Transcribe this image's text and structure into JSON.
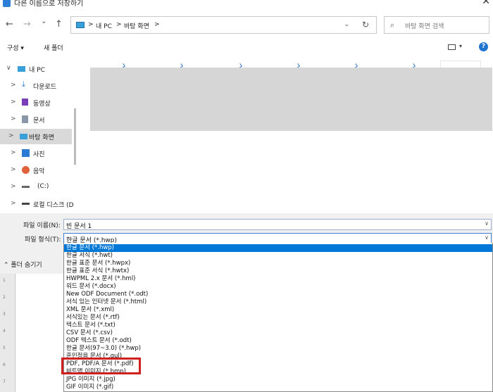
{
  "window": {
    "title": "다른 이름으로 저장하기",
    "close": "✕"
  },
  "nav": {
    "back": "←",
    "forward": "→",
    "recent": "⌄",
    "up": "↑"
  },
  "address": {
    "segments": [
      "내 PC",
      "바탕 화면"
    ],
    "sep": ">",
    "dropdown": "⌄",
    "refresh": "↻"
  },
  "search": {
    "icon": "⌕",
    "placeholder": "바탕 화면 검색"
  },
  "toolbar": {
    "organize": "구성 ▾",
    "new_folder": "새 폴더",
    "view_dd": "▾",
    "help": "?"
  },
  "sidebar": {
    "items": [
      {
        "label": "내 PC",
        "chev": "∨",
        "icon": "pc-icon",
        "color": "#3aa0d8"
      },
      {
        "label": "다운로드",
        "chev": ">",
        "icon": "download-icon",
        "color": "#2a7bd4"
      },
      {
        "label": "동영상",
        "chev": ">",
        "icon": "video-icon",
        "color": "#7a3fb8"
      },
      {
        "label": "문서",
        "chev": ">",
        "icon": "document-icon",
        "color": "#8a97a8"
      },
      {
        "label": "바탕 화면",
        "chev": ">",
        "icon": "desktop-icon",
        "color": "#3aa0d8"
      },
      {
        "label": "사진",
        "chev": ">",
        "icon": "picture-icon",
        "color": "#2a7bd4"
      },
      {
        "label": "음악",
        "chev": ">",
        "icon": "music-icon",
        "color": "#e0623a"
      },
      {
        "label": "(C:)",
        "chev": ">",
        "icon": "drive-icon",
        "color": "#666666"
      },
      {
        "label": "로컬 디스크 (D",
        "chev": ">",
        "icon": "disk-icon",
        "color": "#444444"
      }
    ]
  },
  "form": {
    "filename_label": "파일 이름(N):",
    "filename_value": "빈 문서 1",
    "filetype_label": "파일 형식(T):",
    "filetype_value": "한글 문서 (*.hwp)",
    "arrow": "∨"
  },
  "hide_folders": "⌃  폴더 숨기기",
  "ruler_marks": [
    "1",
    "2",
    "3",
    "4",
    "5",
    "6",
    "7"
  ],
  "filetypes": [
    "한글 문서 (*.hwp)",
    "한글 서식 (*.hwt)",
    "한글 표준 문서 (*.hwpx)",
    "한글 표준 서식 (*.hwtx)",
    "HWPML 2.x 문서 (*.hml)",
    "워드 문서 (*.docx)",
    "New ODF Document (*.odt)",
    "서식 있는 인터넷 문서 (*.html)",
    "XML 문서 (*.xml)",
    "서식있는 문서 (*.rtf)",
    "텍스트 문서 (*.txt)",
    "CSV 문서 (*.csv)",
    "ODF 텍스트 문서 (*.odt)",
    "한글 문서(97~3.0) (*.hwp)",
    "훈민정음 문서 (*.gul)",
    "PDF, PDF/A 문서 (*.pdf)",
    "비트맵 이미지 (*.bmp)",
    "JPG 이미지 (*.jpg)",
    "GIF 이미지 (*.gif)"
  ],
  "selected_filetype_index": 0,
  "highlighted_filetype_index": 15,
  "colors": {
    "selection": "#0078d7",
    "highlight_box": "#d01f1f",
    "accent": "#1f74d1"
  }
}
